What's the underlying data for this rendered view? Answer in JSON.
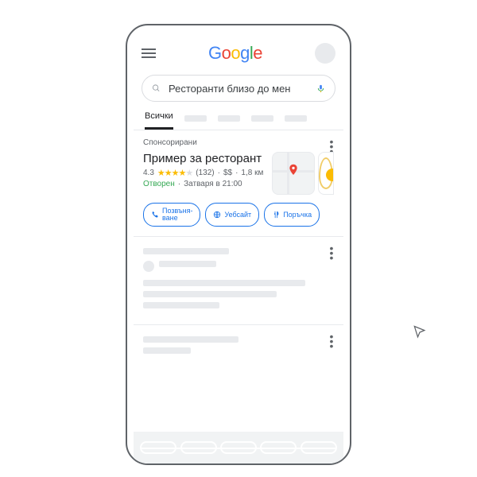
{
  "search": {
    "query": "Ресторанти близо до мен"
  },
  "tabs": {
    "active": "Всички"
  },
  "result": {
    "sponsored_label": "Спонсорирани",
    "title": "Пример за ресторант",
    "rating": "4.3",
    "review_count": "(132)",
    "price": "$$",
    "distance": "1,8 км",
    "status_open": "Отворен",
    "closes_at": "Затваря в 21:00",
    "actions": {
      "call": "Позвъня-\nване",
      "website": "Уебсайт",
      "order": "Поръчка"
    }
  }
}
